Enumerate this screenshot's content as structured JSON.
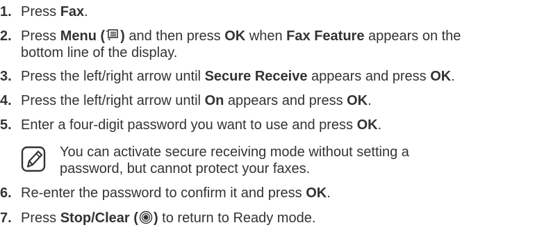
{
  "steps": [
    {
      "num": "1.",
      "pre": "Press ",
      "bold1": "Fax",
      "post": "."
    },
    {
      "num": "2.",
      "pre": "Press ",
      "bold1": "Menu (",
      "icon": "menu-icon",
      "bold1_close": ")",
      "mid": " and then press ",
      "bold2": "OK",
      "mid2": " when ",
      "bold3": "Fax Feature",
      "post": " appears on the",
      "line2": "bottom line of the display."
    },
    {
      "num": "3.",
      "pre": "Press the left/right arrow until ",
      "bold1": "Secure Receive",
      "mid": " appears and press ",
      "bold2": "OK",
      "post": "."
    },
    {
      "num": "4.",
      "pre": "Press the left/right arrow until ",
      "bold1": "On",
      "mid": " appears and press ",
      "bold2": "OK",
      "post": "."
    },
    {
      "num": "5.",
      "pre": "Enter a four-digit password you want to use and press ",
      "bold1": "OK",
      "post": "."
    },
    {
      "num": "6.",
      "pre": "Re-enter the password to confirm it and press ",
      "bold1": "OK",
      "post": "."
    },
    {
      "num": "7.",
      "pre": "Press ",
      "bold1": "Stop/Clear (",
      "icon": "stop-clear-icon",
      "bold1_close": ")",
      "post": " to return to Ready mode."
    }
  ],
  "note": {
    "icon": "note-pencil-icon",
    "line1": "You can activate secure receiving mode without setting a",
    "line2": "password, but cannot protect your faxes."
  }
}
